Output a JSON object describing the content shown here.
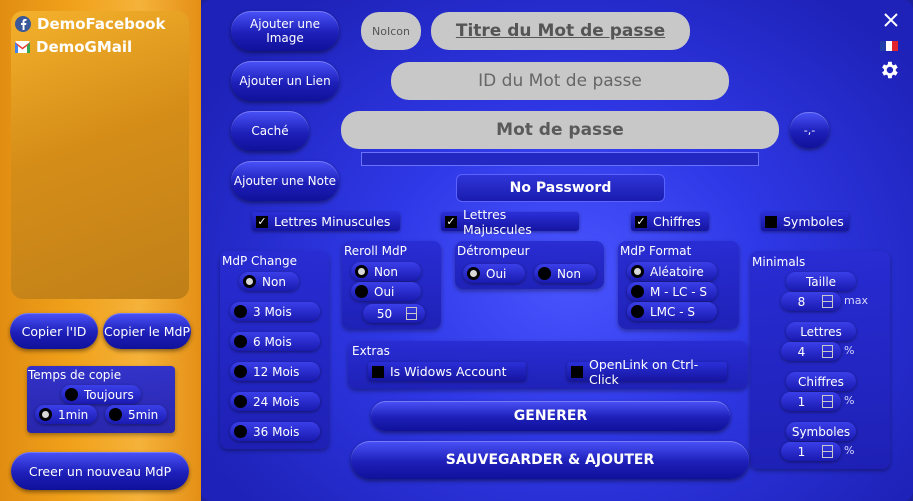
{
  "accounts": [
    "DemoFacebook",
    "DemoGMail"
  ],
  "left_buttons": {
    "copy_id": "Copier l'ID",
    "copy_pwd": "Copier le MdP",
    "new_pwd": "Creer un nouveau MdP"
  },
  "copy_time": {
    "title": "Temps de copie",
    "always": "Toujours",
    "one_min": "1min",
    "five_min": "5min"
  },
  "toolbar": {
    "add_image": "Ajouter une Image",
    "add_link": "Ajouter un Lien",
    "hidden": "Caché",
    "add_note": "Ajouter une Note",
    "reveal": "-,-"
  },
  "fields": {
    "no_icon": "NoIcon",
    "title": "Titre du Mot de passe",
    "id": "ID du Mot de passe",
    "password": "Mot de passe",
    "strength": "No Password"
  },
  "options": {
    "lowercase": "Lettres Minuscules",
    "uppercase": "Lettres Majuscules",
    "digits": "Chiffres",
    "symbols": "Symboles"
  },
  "mdp_change": {
    "title": "MdP Change",
    "items": [
      "Non",
      "3 Mois",
      "6 Mois",
      "12 Mois",
      "24 Mois",
      "36 Mois"
    ]
  },
  "reroll": {
    "title": "Reroll MdP",
    "non": "Non",
    "oui": "Oui",
    "value": "50"
  },
  "detrompeur": {
    "title": "Détrompeur",
    "oui": "Oui",
    "non": "Non"
  },
  "format": {
    "title": "MdP Format",
    "items": [
      "Aléatoire",
      "M - LC - S",
      "LMC - S"
    ]
  },
  "minimals": {
    "title": "Minimals",
    "size_label": "Taille",
    "size_value": "8",
    "size_max": "max",
    "letters_label": "Lettres",
    "letters_value": "4",
    "digits_label": "Chiffres",
    "digits_value": "1",
    "symbols_label": "Symboles",
    "symbols_value": "1",
    "pct": "%"
  },
  "extras": {
    "title": "Extras",
    "windows_account": "Is Widows Account",
    "openlink": "OpenLink on Ctrl-Click"
  },
  "actions": {
    "generate": "GENERER",
    "save": "SAUVEGARDER & AJOUTER"
  },
  "colors": {
    "accent_orange": "#f0a11a",
    "panel_blue": "#2f38e6",
    "field_grey": "#c8c8c8"
  }
}
